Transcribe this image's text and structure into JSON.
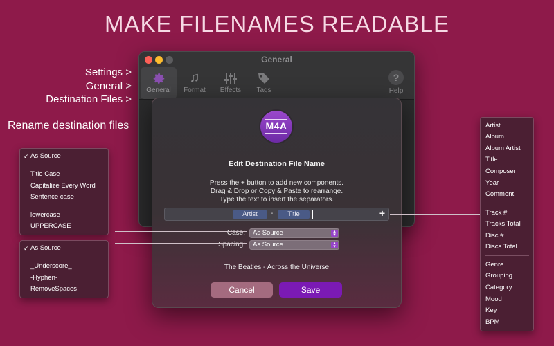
{
  "headline": "MAKE FILENAMES READABLE",
  "breadcrumb": [
    "Settings >",
    "General >",
    "Destination Files >"
  ],
  "rename_label": "Rename destination files",
  "window": {
    "title": "General",
    "tabs": [
      {
        "label": "General",
        "icon": "gear-icon"
      },
      {
        "label": "Format",
        "icon": "music-note-icon"
      },
      {
        "label": "Effects",
        "icon": "sliders-icon"
      },
      {
        "label": "Tags",
        "icon": "tag-icon"
      }
    ],
    "help_label": "Help",
    "help_glyph": "?"
  },
  "sheet": {
    "logo_text": "M4A",
    "title": "Edit Destination File Name",
    "instructions": [
      "Press the + button to add new components.",
      "Drag & Drop or Copy & Paste to rearrange.",
      "Type the text to insert the separators."
    ],
    "tokens": [
      "Artist",
      "-",
      "Title"
    ],
    "add_button": "+",
    "case_label": "Case:",
    "case_value": "As Source",
    "spacing_label": "Spacing:",
    "spacing_value": "As Source",
    "preview": "The Beatles - Across the Universe",
    "cancel_label": "Cancel",
    "save_label": "Save"
  },
  "case_menu": {
    "items": [
      "As Source",
      "Title Case",
      "Capitalize Every Word",
      "Sentence case",
      "lowercase",
      "UPPERCASE"
    ],
    "checked": "As Source",
    "check_glyph": "✓"
  },
  "spacing_menu": {
    "items": [
      "As Source",
      "_Underscore_",
      "-Hyphen-",
      "RemoveSpaces"
    ],
    "checked": "As Source",
    "check_glyph": "✓"
  },
  "components_menu": {
    "groups": [
      [
        "Artist",
        "Album",
        "Album Artist",
        "Title",
        "Composer",
        "Year",
        "Comment"
      ],
      [
        "Track #",
        "Tracks Total",
        "Disc #",
        "Discs Total"
      ],
      [
        "Genre",
        "Grouping",
        "Category",
        "Mood",
        "Key",
        "BPM"
      ]
    ]
  },
  "colors": {
    "background": "#8e1a4a",
    "accent": "#7b1ab4",
    "token": "#4a5a86"
  }
}
